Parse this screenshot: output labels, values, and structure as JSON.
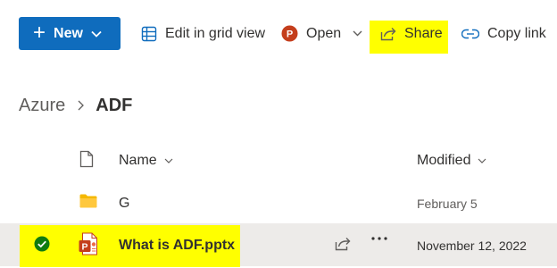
{
  "toolbar": {
    "new_label": "New",
    "grid_label": "Edit in grid view",
    "open_label": "Open",
    "share_label": "Share",
    "copy_label": "Copy link"
  },
  "breadcrumb": {
    "root": "Azure",
    "current": "ADF"
  },
  "columns": {
    "name": "Name",
    "modified": "Modified"
  },
  "rows": [
    {
      "name": "G",
      "modified": "February 5",
      "type": "folder-icon",
      "selected": false
    },
    {
      "name": "What is ADF.pptx",
      "modified": "November 12, 2022",
      "type": "powerpoint-file-icon",
      "selected": true
    }
  ],
  "colors": {
    "accent": "#0f6cbd",
    "highlight": "#ffff00",
    "powerpoint": "#c43e1c",
    "check": "#107c10",
    "selected_row": "#edebe9"
  }
}
